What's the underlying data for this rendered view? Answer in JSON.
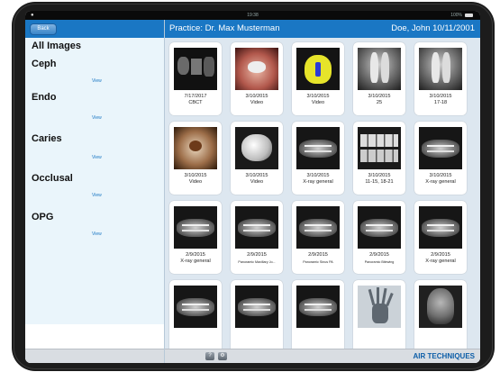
{
  "status_bar": {
    "time": "19:38",
    "battery": "100%"
  },
  "sidebar": {
    "back_label": "Back",
    "all_images_label": "All Images",
    "categories": [
      {
        "label": "Ceph",
        "view": "View"
      },
      {
        "label": "Endo",
        "view": "View"
      },
      {
        "label": "Caries",
        "view": "View"
      },
      {
        "label": "Occlusal",
        "view": "View"
      },
      {
        "label": "OPG",
        "view": "View"
      }
    ]
  },
  "header": {
    "practice": "Practice: Dr. Max Musterman",
    "patient": "Doe, John 10/11/2001"
  },
  "images": [
    {
      "date": "7/17/2017",
      "caption": "CBCT",
      "kind": "cbct"
    },
    {
      "date": "3/10/2015",
      "caption": "Video",
      "kind": "video-mouth"
    },
    {
      "date": "3/10/2015",
      "caption": "Video",
      "kind": "video-yellow"
    },
    {
      "date": "3/10/2015",
      "caption": "25",
      "kind": "xray-tooth"
    },
    {
      "date": "3/10/2015",
      "caption": "17-18",
      "kind": "xray-tooth"
    },
    {
      "date": "3/10/2015",
      "caption": "Video",
      "kind": "video-tooth"
    },
    {
      "date": "3/10/2015",
      "caption": "Video",
      "kind": "video-white"
    },
    {
      "date": "3/10/2015",
      "caption": "X-ray general",
      "kind": "xray-pan"
    },
    {
      "date": "3/10/2015",
      "caption": "11-15, 18-21",
      "kind": "xray-bite"
    },
    {
      "date": "3/10/2015",
      "caption": "X-ray general",
      "kind": "xray-pan"
    },
    {
      "date": "2/9/2015",
      "caption": "X-ray general",
      "kind": "xray-pan"
    },
    {
      "date": "2/9/2015",
      "caption": "Panoramic Maxillary Jo...",
      "kind": "xray-pan"
    },
    {
      "date": "2/9/2015",
      "caption": "Panoramic Sinus PA",
      "kind": "xray-pan"
    },
    {
      "date": "2/9/2015",
      "caption": "Panoramic Bitewing",
      "kind": "xray-pan"
    },
    {
      "date": "2/9/2015",
      "caption": "X-ray general",
      "kind": "xray-pan"
    },
    {
      "date": "",
      "caption": "",
      "kind": "xray-pan"
    },
    {
      "date": "",
      "caption": "",
      "kind": "xray-pan"
    },
    {
      "date": "",
      "caption": "",
      "kind": "xray-pan"
    },
    {
      "date": "",
      "caption": "",
      "kind": "xray-hand"
    },
    {
      "date": "",
      "caption": "",
      "kind": "xray-ceph"
    }
  ],
  "footer": {
    "help_label": "?",
    "settings_label": "⚙",
    "logo_top": "AIR",
    "logo_bottom": "TECHNIQUES"
  },
  "colors": {
    "header_blue": "#1a77c4",
    "sidebar_bg": "#eaf5fb",
    "grid_bg": "#dde7f0"
  }
}
